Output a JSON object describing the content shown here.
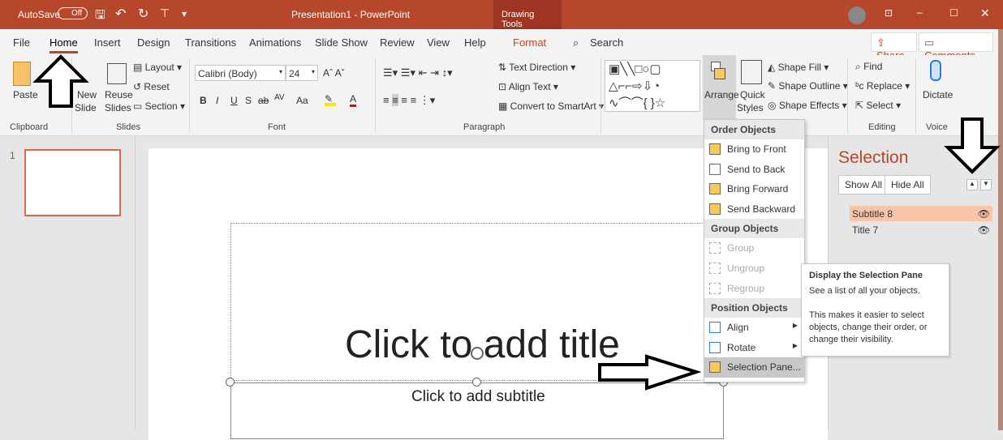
{
  "titlebar": {
    "autosave": "AutoSave",
    "autosave_state": "Off",
    "title": "Presentation1 - PowerPoint",
    "context_tab": "Drawing Tools"
  },
  "tabs": [
    "File",
    "Home",
    "Insert",
    "Design",
    "Transitions",
    "Animations",
    "Slide Show",
    "Review",
    "View",
    "Help",
    "Format"
  ],
  "search": "Search",
  "share": "Share",
  "comments": "Comments",
  "ribbon": {
    "clipboard": {
      "paste": "Paste",
      "label": "Clipboard"
    },
    "slides": {
      "new": "New",
      "slide": "Slide",
      "reuse": "Reuse",
      "reuse2": "Slides",
      "layout": "Layout",
      "reset": "Reset",
      "section": "Section",
      "label": "Slides"
    },
    "font": {
      "name": "Calibri (Body)",
      "size": "24",
      "bold": "B",
      "italic": "I",
      "underline": "U",
      "shadow": "S",
      "strike": "ab",
      "spacing": "AV",
      "case": "Aa",
      "color": "A",
      "label": "Font"
    },
    "paragraph": {
      "text_direction": "Text Direction",
      "align_text": "Align Text",
      "convert": "Convert to SmartArt",
      "label": "Paragraph"
    },
    "drawing": {
      "arrange": "Arrange",
      "quick": "Quick",
      "styles": "Styles",
      "fill": "Shape Fill",
      "outline": "Shape Outline",
      "effects": "Shape Effects"
    },
    "editing": {
      "find": "Find",
      "replace": "Replace",
      "select": "Select",
      "label": "Editing"
    },
    "voice": {
      "dictate": "Dictate",
      "label": "Voice"
    }
  },
  "thumbnail": {
    "number": "1"
  },
  "slide": {
    "title": "Click to add title",
    "subtitle": "Click to add subtitle"
  },
  "menu": {
    "sections": [
      {
        "header": "Order Objects",
        "items": [
          {
            "label": "Bring to Front",
            "disabled": false
          },
          {
            "label": "Send to Back",
            "disabled": false
          },
          {
            "label": "Bring Forward",
            "disabled": false
          },
          {
            "label": "Send Backward",
            "disabled": false
          }
        ]
      },
      {
        "header": "Group Objects",
        "items": [
          {
            "label": "Group",
            "disabled": true
          },
          {
            "label": "Ungroup",
            "disabled": true
          },
          {
            "label": "Regroup",
            "disabled": true
          }
        ]
      },
      {
        "header": "Position Objects",
        "items": [
          {
            "label": "Align",
            "disabled": false
          },
          {
            "label": "Rotate",
            "disabled": false
          },
          {
            "label": "Selection Pane...",
            "disabled": false
          }
        ]
      }
    ]
  },
  "tooltip": {
    "title": "Display the Selection Pane",
    "line1": "See a list of all your objects.",
    "line2": "This makes it easier to select objects, change their order, or change their visibility."
  },
  "selection_pane": {
    "title": "Selection",
    "show_all": "Show All",
    "hide_all": "Hide All",
    "items": [
      "Subtitle 8",
      "Title 7"
    ]
  }
}
